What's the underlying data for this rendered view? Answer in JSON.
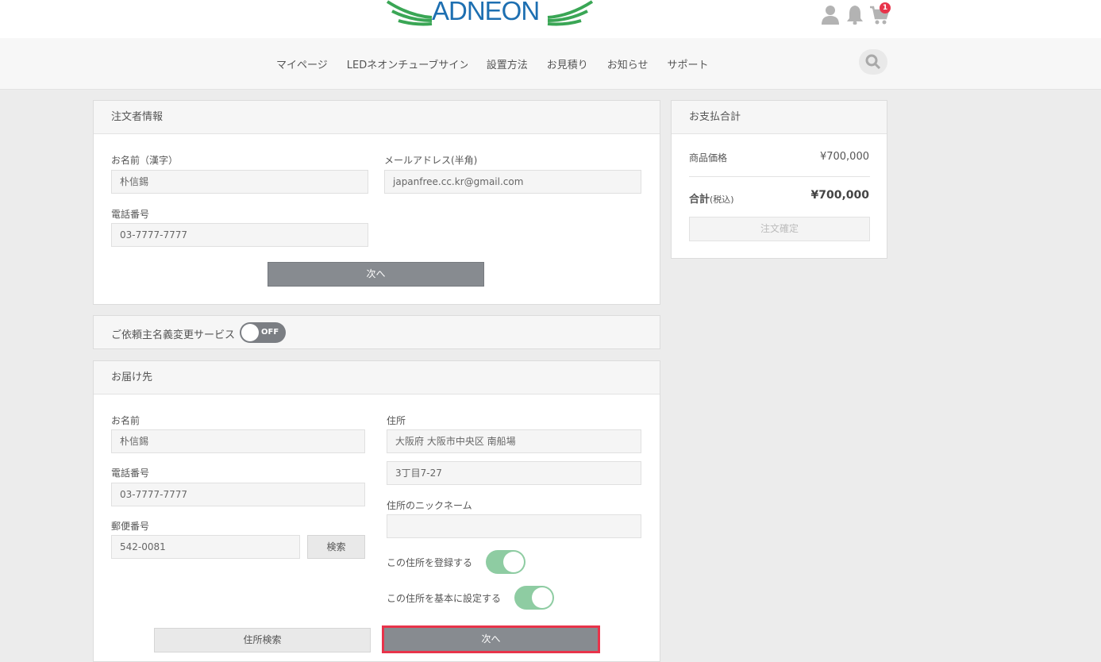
{
  "brand": {
    "logo_text": "ADNEON",
    "accent": "#1d6fb1",
    "wing_color": "#3aa655"
  },
  "header": {
    "cart_count": "1"
  },
  "nav": {
    "items": [
      "マイページ",
      "LEDネオンチューブサイン",
      "設置方法",
      "お見積り",
      "お知らせ",
      "サポート"
    ]
  },
  "orderer": {
    "title": "注文者情報",
    "name_label": "お名前（漢字）",
    "name_value": "朴信錫",
    "email_label": "メールアドレス(半角)",
    "email_value": "japanfree.cc.kr@gmail.com",
    "phone_label": "電話番号",
    "phone_value": "03-7777-7777",
    "next_label": "次へ"
  },
  "service": {
    "title": "ご依頼主名義変更サービス",
    "toggle_label": "OFF"
  },
  "delivery": {
    "title": "お届け先",
    "name_label": "お名前",
    "name_value": "朴信錫",
    "phone_label": "電話番号",
    "phone_value": "03-7777-7777",
    "zip_label": "郵便番号",
    "zip_value": "542-0081",
    "search_label": "検索",
    "address_label": "住所",
    "address1_value": "大阪府 大阪市中央区 南船場",
    "address2_value": "3丁目7-27",
    "nickname_label": "住所のニックネーム",
    "nickname_value": "",
    "register_label": "この住所を登録する",
    "default_label": "この住所を基本に設定する",
    "address_search_label": "住所検索",
    "next_label": "次へ"
  },
  "summary": {
    "title": "お支払合計",
    "price_label": "商品価格",
    "price_value": "¥700,000",
    "total_label": "合計",
    "total_tax": "(税込)",
    "total_value": "¥700,000",
    "confirm_label": "注文確定"
  },
  "colors": {
    "highlight": "#e8334a",
    "toggle_on": "#8ecca2",
    "button_dark": "#878b90"
  }
}
